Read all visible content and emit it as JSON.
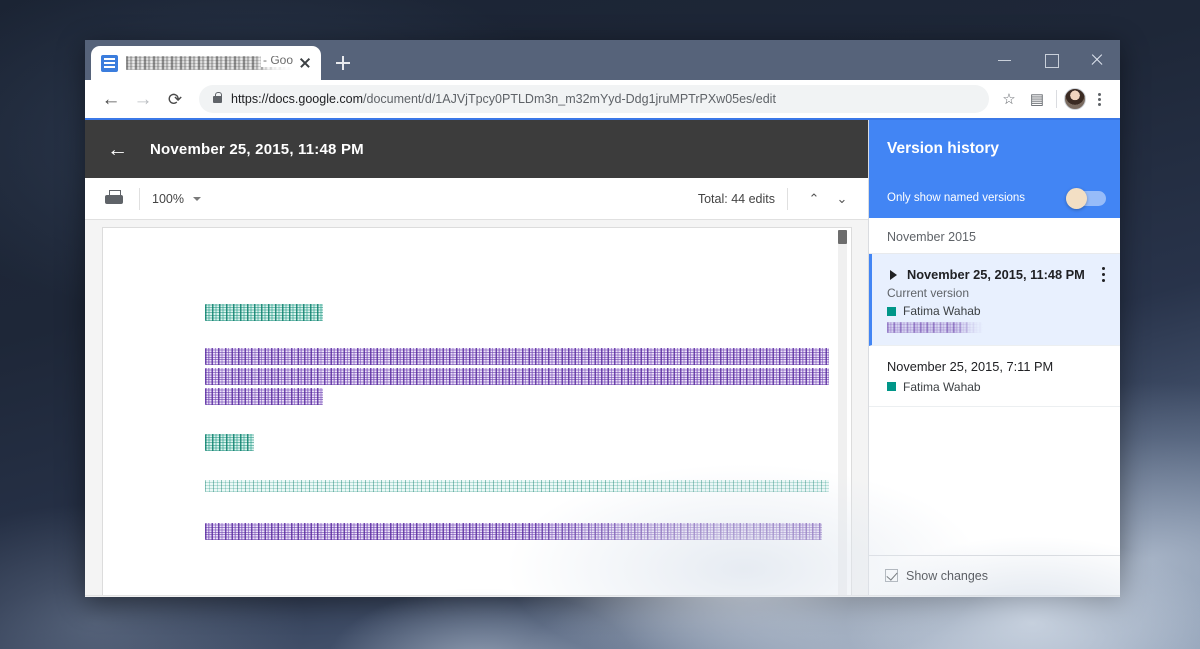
{
  "browser": {
    "tab": {
      "title_redacted": true,
      "title_suffix": "- Goo",
      "favicon": "google-docs-icon",
      "close_label": "×"
    },
    "newtab_label": "+",
    "window_controls": {
      "minimize": "–",
      "maximize": "▢",
      "close": "×"
    },
    "nav": {
      "back": "←",
      "forward": "→",
      "reload": "⟳"
    },
    "omnibox": {
      "url_host": "https://docs.google.com",
      "url_path": "/document/d/1AJVjTpcy0PTLDm3n_m32mYyd-Ddg1jruMPTrPXw05es/edit",
      "full_url": "https://docs.google.com/document/d/1AJVjTpcy0PTLDm3n_m32mYyd-Ddg1jruMPTrPXw05es/edit",
      "secure": true
    },
    "actions": {
      "bookmark": "☆",
      "extension": "▤",
      "profile": "avatar",
      "menu": "⋮"
    }
  },
  "doc_header": {
    "back_label": "←",
    "title": "November 25, 2015, 11:48 PM"
  },
  "doc_toolbar": {
    "print_label": "print-icon",
    "zoom_value": "100%",
    "zoom_caret": "▾",
    "total_edits": "Total: 44 edits",
    "prev_label": "⌃",
    "next_label": "⌄"
  },
  "document": {
    "content_redacted": true,
    "lines": [
      {
        "style": "teal",
        "width": "19%"
      },
      {
        "style": "spacer",
        "width": "0%"
      },
      {
        "style": "purple",
        "width": "100%"
      },
      {
        "style": "purple",
        "width": "100%"
      },
      {
        "style": "purple",
        "width": "19%"
      },
      {
        "style": "spacer",
        "width": "0%"
      },
      {
        "style": "teal",
        "width": "8%"
      },
      {
        "style": "spacer",
        "width": "0%"
      },
      {
        "style": "tealfaint",
        "width": "100%"
      },
      {
        "style": "spacer",
        "width": "0%"
      },
      {
        "style": "purple",
        "width": "99%"
      }
    ]
  },
  "version_history": {
    "title": "Version history",
    "toggle": {
      "label": "Only show named versions",
      "enabled": false
    },
    "month_group": "November 2015",
    "versions": [
      {
        "date": "November 25, 2015, 11:48 PM",
        "subtitle": "Current version",
        "author": "Fatima Wahab",
        "author_color": "#009688",
        "selected": true,
        "expandable": true,
        "has_menu": true,
        "named_label_redacted": true
      },
      {
        "date": "November 25, 2015, 7:11 PM",
        "subtitle": "",
        "author": "Fatima Wahab",
        "author_color": "#009688",
        "selected": false,
        "expandable": false,
        "has_menu": false,
        "named_label_redacted": false
      }
    ],
    "footer": {
      "show_changes_label": "Show changes",
      "show_changes_checked": true
    }
  },
  "colors": {
    "accent_blue": "#4285f4",
    "doc_header_dark": "#3c3c3c",
    "titlebar": "#56637a",
    "author_swatch": "#009688",
    "selected_row": "#e8f0fe"
  }
}
